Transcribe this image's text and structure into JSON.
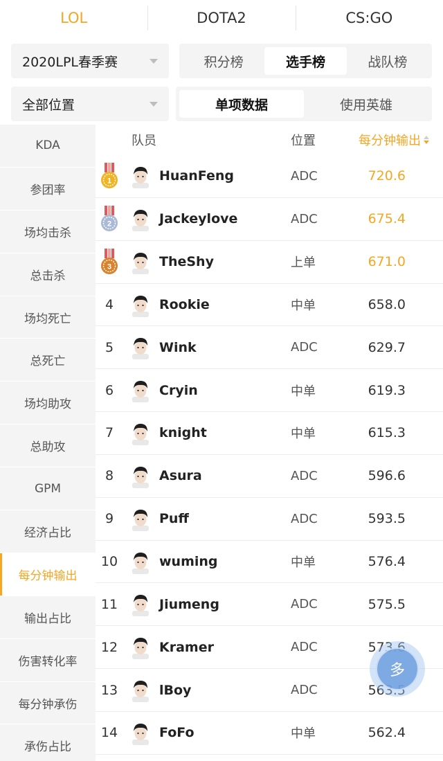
{
  "game_tabs": [
    {
      "label": "LOL",
      "active": true
    },
    {
      "label": "DOTA2",
      "active": false
    },
    {
      "label": "CS:GO",
      "active": false
    }
  ],
  "filters": {
    "season": "2020LPL春季赛",
    "position": "全部位置"
  },
  "board_tabs": [
    {
      "label": "积分榜",
      "active": false
    },
    {
      "label": "选手榜",
      "active": true
    },
    {
      "label": "战队榜",
      "active": false
    }
  ],
  "data_tabs": [
    {
      "label": "单项数据",
      "active": true
    },
    {
      "label": "使用英雄",
      "active": false
    }
  ],
  "side_menu": [
    {
      "label": "KDA",
      "active": false
    },
    {
      "label": "参团率",
      "active": false
    },
    {
      "label": "场均击杀",
      "active": false
    },
    {
      "label": "总击杀",
      "active": false
    },
    {
      "label": "场均死亡",
      "active": false
    },
    {
      "label": "总死亡",
      "active": false
    },
    {
      "label": "场均助攻",
      "active": false
    },
    {
      "label": "总助攻",
      "active": false
    },
    {
      "label": "GPM",
      "active": false
    },
    {
      "label": "经济占比",
      "active": false
    },
    {
      "label": "每分钟输出",
      "active": true
    },
    {
      "label": "输出占比",
      "active": false
    },
    {
      "label": "伤害转化率",
      "active": false
    },
    {
      "label": "每分钟承伤",
      "active": false
    },
    {
      "label": "承伤占比",
      "active": false
    }
  ],
  "table": {
    "headers": {
      "player": "队员",
      "position": "位置",
      "metric": "每分钟输出"
    },
    "rows": [
      {
        "rank": "1",
        "medal": "gold-medal-icon",
        "name": "HuanFeng",
        "position": "ADC",
        "value": "720.6"
      },
      {
        "rank": "2",
        "medal": "silver-medal-icon",
        "name": "Jackeylove",
        "position": "ADC",
        "value": "675.4"
      },
      {
        "rank": "3",
        "medal": "bronze-medal-icon",
        "name": "TheShy",
        "position": "上单",
        "value": "671.0"
      },
      {
        "rank": "4",
        "medal": null,
        "name": "Rookie",
        "position": "中单",
        "value": "658.0"
      },
      {
        "rank": "5",
        "medal": null,
        "name": "Wink",
        "position": "ADC",
        "value": "629.7"
      },
      {
        "rank": "6",
        "medal": null,
        "name": "Cryin",
        "position": "中单",
        "value": "619.3"
      },
      {
        "rank": "7",
        "medal": null,
        "name": "knight",
        "position": "中单",
        "value": "615.3"
      },
      {
        "rank": "8",
        "medal": null,
        "name": "Asura",
        "position": "ADC",
        "value": "596.6"
      },
      {
        "rank": "9",
        "medal": null,
        "name": "Puff",
        "position": "ADC",
        "value": "593.5"
      },
      {
        "rank": "10",
        "medal": null,
        "name": "wuming",
        "position": "中单",
        "value": "576.4"
      },
      {
        "rank": "11",
        "medal": null,
        "name": "Jiumeng",
        "position": "ADC",
        "value": "575.5"
      },
      {
        "rank": "12",
        "medal": null,
        "name": "Kramer",
        "position": "ADC",
        "value": "573.6"
      },
      {
        "rank": "13",
        "medal": null,
        "name": "lBoy",
        "position": "ADC",
        "value": "563.5"
      },
      {
        "rank": "14",
        "medal": null,
        "name": "FoFo",
        "position": "中单",
        "value": "562.4"
      }
    ]
  },
  "fab": {
    "label": "多"
  },
  "colors": {
    "accent": "#f5a623",
    "panel": "#f4f4f4",
    "gold": "#f0b323",
    "silver": "#a9b9d6",
    "bronze": "#d9822b",
    "ribbon": "#e05a5a"
  }
}
